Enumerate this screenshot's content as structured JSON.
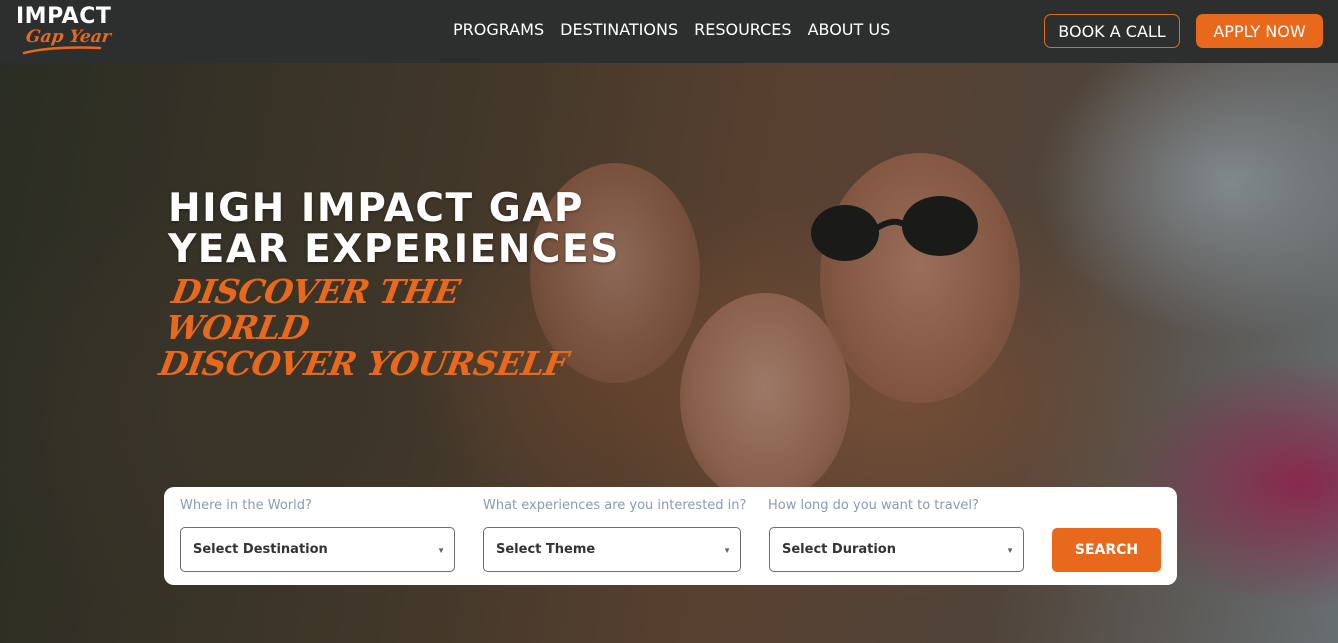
{
  "brand": {
    "logo_main": "IMPACT",
    "logo_sub": "Gap Year",
    "accent_color": "#e8691c"
  },
  "nav": {
    "items": [
      {
        "label": "PROGRAMS"
      },
      {
        "label": "DESTINATIONS"
      },
      {
        "label": "RESOURCES"
      },
      {
        "label": "ABOUT US"
      }
    ],
    "book_call": "BOOK A CALL",
    "apply_now": "APPLY NOW"
  },
  "hero": {
    "headline_line1": "HIGH IMPACT GAP",
    "headline_line2": "YEAR EXPERIENCES",
    "tagline_line1": "DISCOVER THE WORLD",
    "tagline_line2": "DISCOVER YOURSELF"
  },
  "search": {
    "destination": {
      "label": "Where in the World?",
      "selected": "Select Destination"
    },
    "theme": {
      "label": "What experiences are you interested in?",
      "selected": "Select Theme"
    },
    "duration": {
      "label": "How long do you want to travel?",
      "selected": "Select Duration"
    },
    "button": "SEARCH"
  }
}
